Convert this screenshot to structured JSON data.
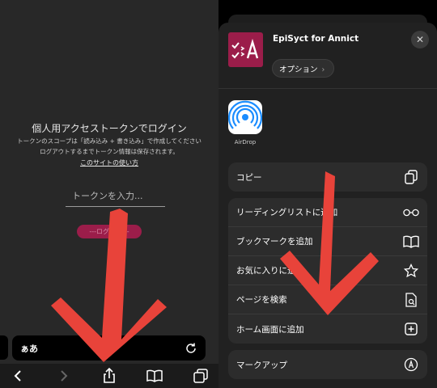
{
  "left": {
    "login_title": "個人用アクセストークンでログイン",
    "login_desc_line1": "トークンのスコープは「読み込み + 書き込み」で作成してください",
    "login_desc_line2": "ログアウトするまでトークン情報は保存されます。",
    "site_usage_link": "このサイトの使い方",
    "token_placeholder": "トークンを入力...",
    "login_button": "---ログイン---",
    "address_text": "ぁあ"
  },
  "share_sheet": {
    "app_name": "EpiSyct for Annict",
    "options_label": "オプション",
    "close_symbol": "✕",
    "airdrop_label": "AirDrop",
    "group1": [
      {
        "label": "コピー",
        "icon": "copy-icon"
      }
    ],
    "group2": [
      {
        "label": "リーディングリストに追加",
        "icon": "glasses-icon"
      },
      {
        "label": "ブックマークを追加",
        "icon": "book-icon"
      },
      {
        "label": "お気に入りに追加",
        "icon": "star-icon"
      },
      {
        "label": "ページを検索",
        "icon": "find-in-page-icon"
      },
      {
        "label": "ホーム画面に追加",
        "icon": "add-square-icon"
      }
    ],
    "group3": [
      {
        "label": "マークアップ",
        "icon": "markup-icon"
      }
    ]
  },
  "colors": {
    "brand": "#9b1d4a",
    "arrow": "#e8433a"
  }
}
